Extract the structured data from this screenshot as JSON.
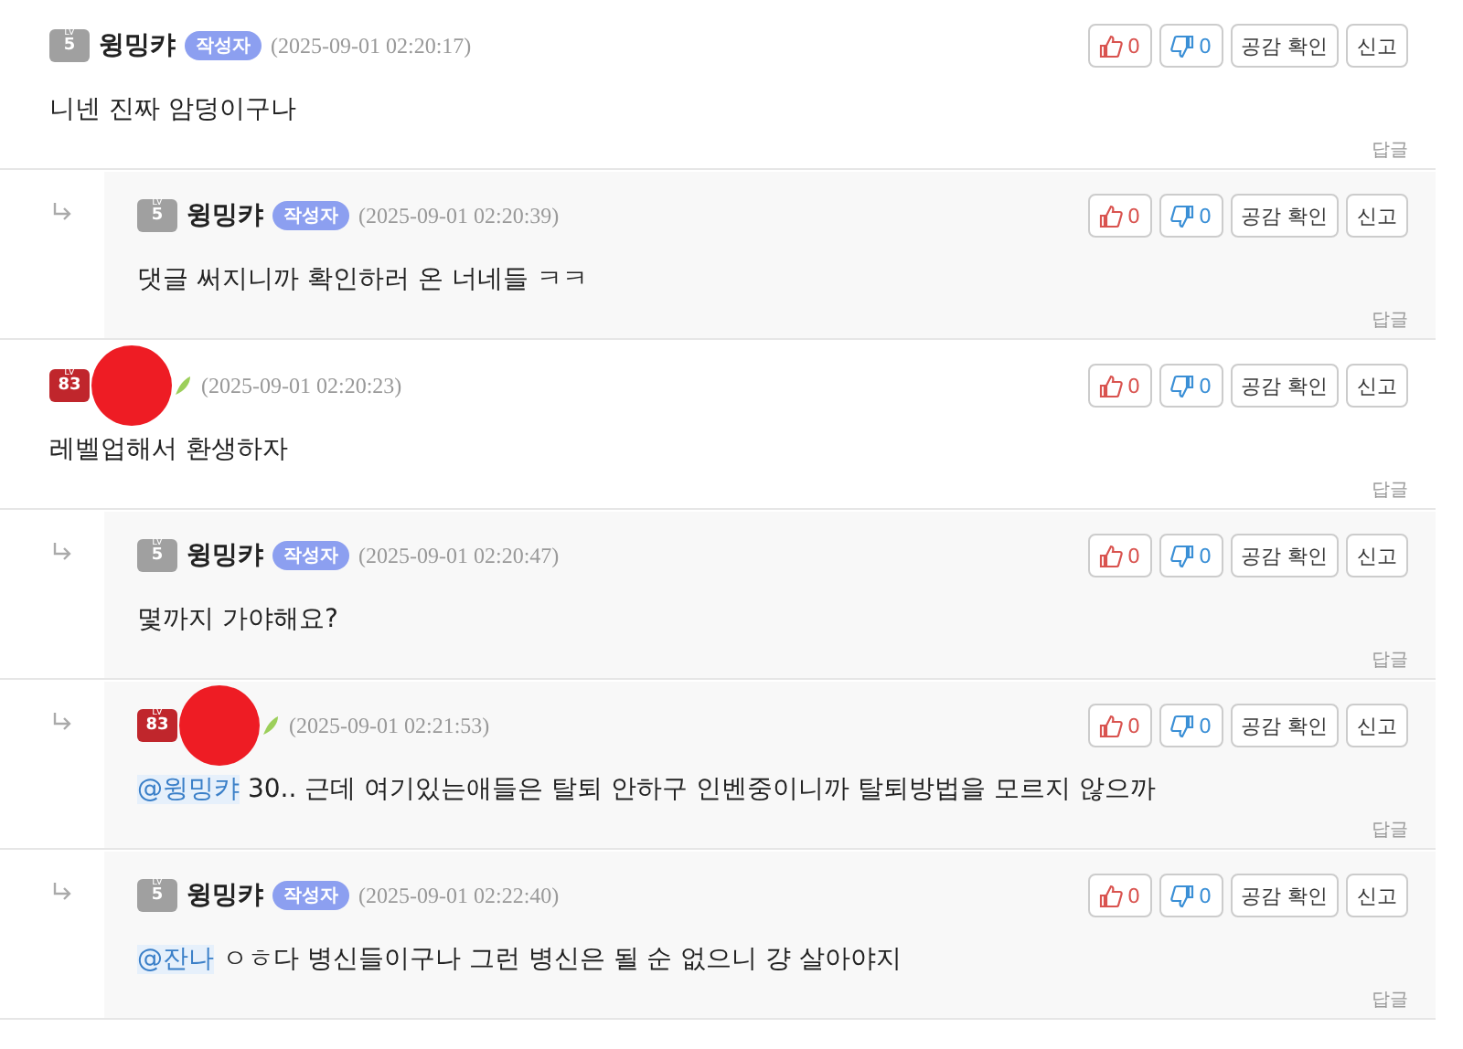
{
  "comments": [
    {
      "reply": false,
      "redacted": false,
      "leaf": false,
      "level_label": "LV",
      "level": "5",
      "color": "#a0a0a0",
      "author": "윙밍캬",
      "writer_badge": "작성자",
      "time": "(2025-09-01 02:20:17)",
      "text": "니넨 진짜 암덩이구나",
      "like": "0",
      "dislike": "0",
      "check": "공감 확인",
      "report": "신고",
      "reply_link": "답글"
    },
    {
      "reply": true,
      "redacted": false,
      "leaf": false,
      "level_label": "LV",
      "level": "5",
      "color": "#a0a0a0",
      "author": "윙밍캬",
      "writer_badge": "작성자",
      "time": "(2025-09-01 02:20:39)",
      "text": "댓글 써지니까 확인하러 온 너네들 ㅋㅋ",
      "like": "0",
      "dislike": "0",
      "check": "공감 확인",
      "report": "신고",
      "reply_link": "답글"
    },
    {
      "reply": false,
      "redacted": true,
      "leaf": true,
      "level_label": "LV",
      "level": "83",
      "color": "#c0262c",
      "time": "(2025-09-01 02:20:23)",
      "text": "레벨업해서 환생하자",
      "like": "0",
      "dislike": "0",
      "check": "공감 확인",
      "report": "신고",
      "reply_link": "답글"
    },
    {
      "reply": true,
      "redacted": false,
      "leaf": false,
      "level_label": "LV",
      "level": "5",
      "color": "#a0a0a0",
      "author": "윙밍캬",
      "writer_badge": "작성자",
      "time": "(2025-09-01 02:20:47)",
      "text": "몇까지 가야해요?",
      "like": "0",
      "dislike": "0",
      "check": "공감 확인",
      "report": "신고",
      "reply_link": "답글"
    },
    {
      "reply": true,
      "redacted": true,
      "leaf": true,
      "level_label": "LV",
      "level": "83",
      "color": "#c0262c",
      "time": "(2025-09-01 02:21:53)",
      "mention": "@윙밍캬",
      "text": "30.. 근데 여기있는애들은 탈퇴 안하구 인벤중이니까 탈퇴방법을 모르지 않으까",
      "like": "0",
      "dislike": "0",
      "check": "공감 확인",
      "report": "신고",
      "reply_link": "답글"
    },
    {
      "reply": true,
      "redacted": false,
      "leaf": false,
      "level_label": "LV",
      "level": "5",
      "color": "#a0a0a0",
      "author": "윙밍캬",
      "writer_badge": "작성자",
      "time": "(2025-09-01 02:22:40)",
      "mention": "@잔나",
      "text": "ㅇㅎ다 병신들이구나 그런 병신은 될 순 없으니 걍 살아야지",
      "like": "0",
      "dislike": "0",
      "check": "공감 확인",
      "report": "신고",
      "reply_link": "답글"
    }
  ]
}
